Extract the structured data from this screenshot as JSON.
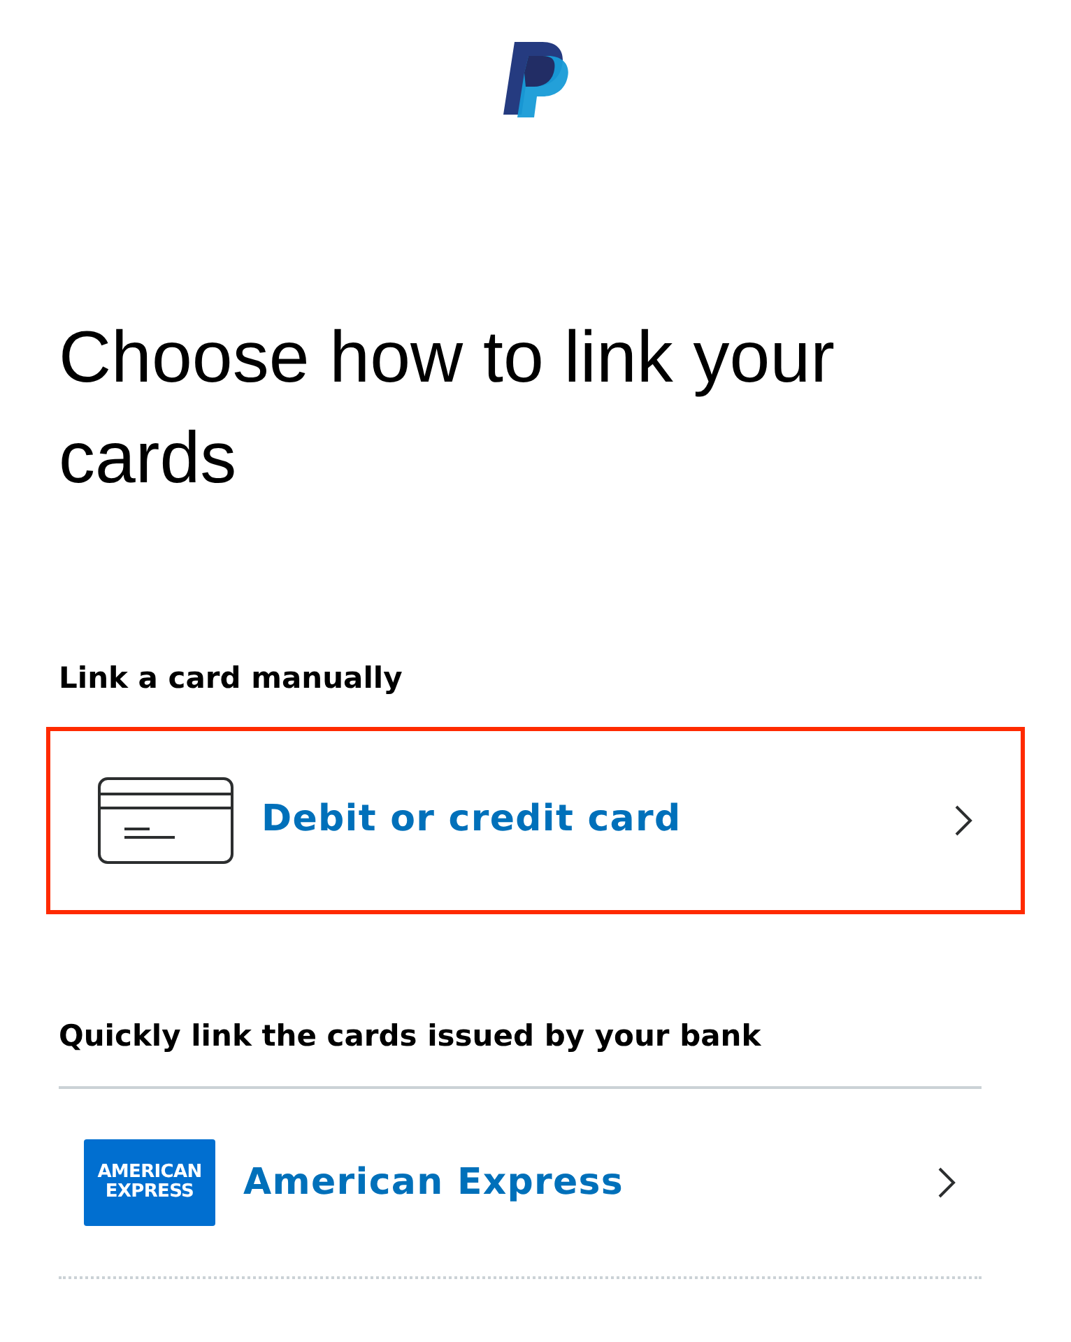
{
  "heading": "Choose how to link your cards",
  "sections": [
    {
      "title": "Link a card manually",
      "items": [
        {
          "kind": "card",
          "label": "Debit or credit card",
          "highlighted": true
        }
      ]
    },
    {
      "title": "Quickly link the cards issued by your bank",
      "items": [
        {
          "kind": "bank",
          "label": "American Express",
          "logo_lines": [
            "AMERICAN",
            "EXPRESS"
          ],
          "highlighted": false
        }
      ]
    }
  ]
}
